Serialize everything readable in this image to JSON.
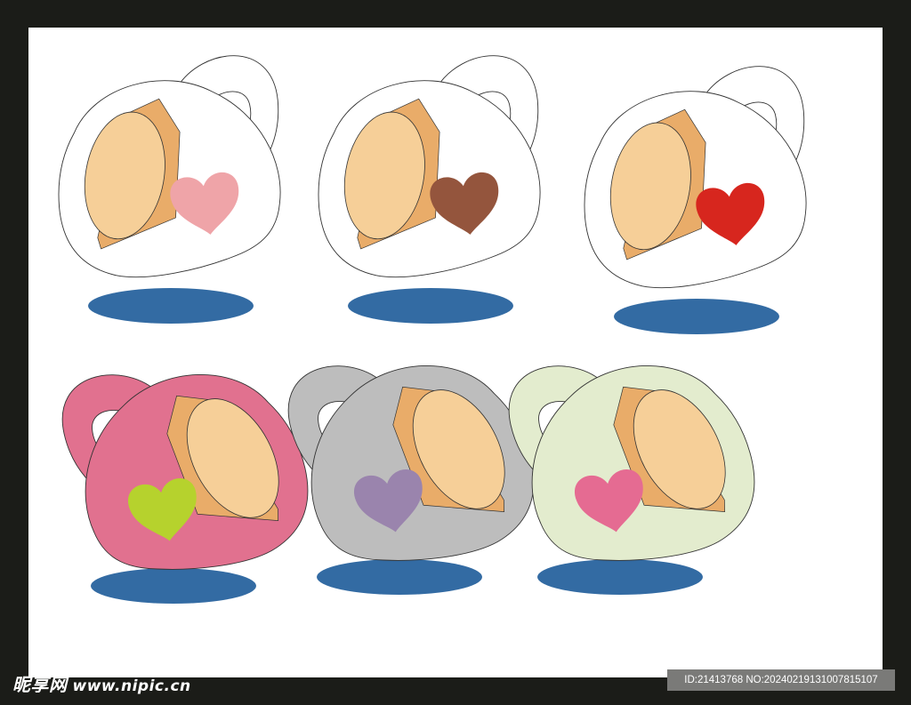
{
  "watermark": {
    "logo_cn": "昵享网",
    "logo_url": "www.nipic.cn",
    "id_text": "ID:21413768 NO:20240219131007815107"
  },
  "colors": {
    "frame": "#1b1c18",
    "canvas": "#ffffff",
    "shadow": "#336ba3",
    "lid_face": "#f6cf98",
    "lid_side": "#e9ac69",
    "outline": "#333333"
  },
  "mugs": [
    {
      "name": "mug-white-pink-heart",
      "body": "#ffffff",
      "heart": "#efa4a8",
      "facing": "right"
    },
    {
      "name": "mug-white-brown-heart",
      "body": "#ffffff",
      "heart": "#94553d",
      "facing": "right"
    },
    {
      "name": "mug-white-red-heart",
      "body": "#ffffff",
      "heart": "#d7261e",
      "facing": "right"
    },
    {
      "name": "mug-pink-green-heart",
      "body": "#e1718f",
      "heart": "#b6d22d",
      "facing": "left"
    },
    {
      "name": "mug-gray-purple-heart",
      "body": "#bdbdbd",
      "heart": "#9a84ad",
      "facing": "left"
    },
    {
      "name": "mug-mint-pink-heart",
      "body": "#e3ecce",
      "heart": "#e56b92",
      "facing": "left"
    }
  ]
}
